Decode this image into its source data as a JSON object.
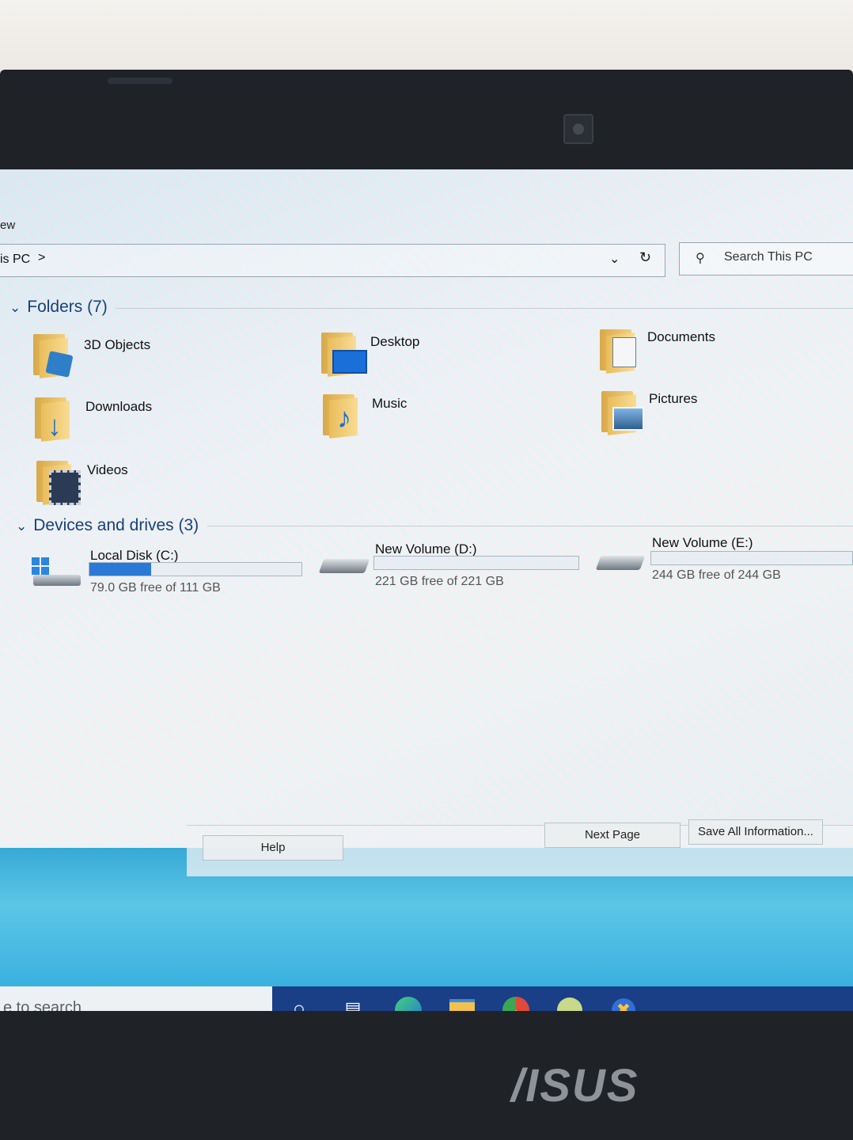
{
  "explorer": {
    "menu_fragment": "ew",
    "address": {
      "path_fragment": "is PC",
      "separator": ">"
    },
    "search_placeholder": "Search This PC",
    "folders_section": {
      "title": "Folders (7)",
      "items": [
        {
          "label": "3D Objects",
          "icon": "3d-objects-folder-icon"
        },
        {
          "label": "Desktop",
          "icon": "desktop-folder-icon"
        },
        {
          "label": "Documents",
          "icon": "documents-folder-icon"
        },
        {
          "label": "Downloads",
          "icon": "downloads-folder-icon"
        },
        {
          "label": "Music",
          "icon": "music-folder-icon"
        },
        {
          "label": "Pictures",
          "icon": "pictures-folder-icon"
        },
        {
          "label": "Videos",
          "icon": "videos-folder-icon"
        }
      ]
    },
    "drives_section": {
      "title": "Devices and drives (3)",
      "drives": [
        {
          "label": "Local Disk (C:)",
          "free_text": "79.0 GB free of 111 GB",
          "used_fraction": 0.29
        },
        {
          "label": "New Volume (D:)",
          "free_text": "221 GB free of 221 GB",
          "used_fraction": 0.0
        },
        {
          "label": "New Volume (E:)",
          "free_text": "244 GB free of 244 GB",
          "used_fraction": 0.0
        }
      ]
    }
  },
  "dialog_buttons": {
    "help": "Help",
    "next_page": "Next Page",
    "save_all": "Save All Information..."
  },
  "taskbar": {
    "search_placeholder": "e to search",
    "apps": [
      "cortana-icon",
      "task-view-icon",
      "edge-icon",
      "file-explorer-icon",
      "chrome-icon",
      "app-icon",
      "tool-icon"
    ]
  },
  "laptop_brand": "/ISUS",
  "colors": {
    "accent": "#2a7ad5",
    "taskbar": "#1a3f86",
    "section_title": "#1a3f7a"
  }
}
